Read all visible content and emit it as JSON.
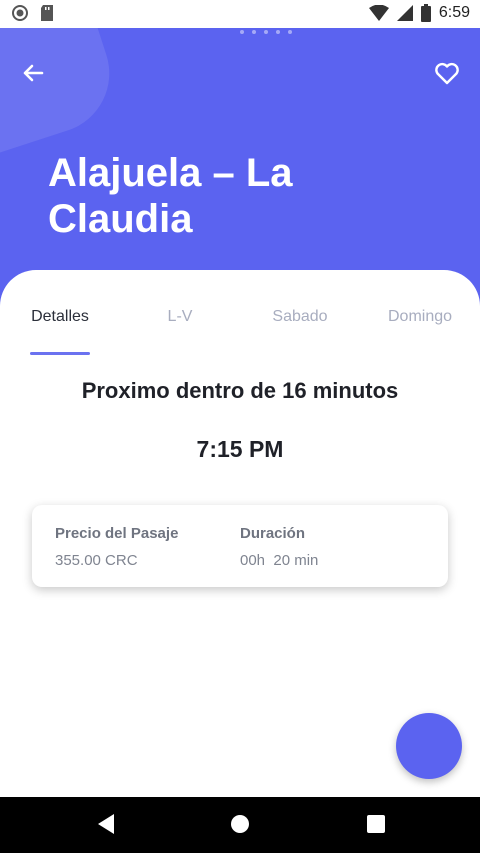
{
  "status": {
    "time": "6:59"
  },
  "header": {
    "title": "Alajuela – La Claudia",
    "back_icon": "arrow-left-icon",
    "favorite_icon": "heart-outline-icon",
    "color": "#5b63f0"
  },
  "tabs": [
    {
      "label": "Detalles",
      "active": true
    },
    {
      "label": "L-V",
      "active": false
    },
    {
      "label": "Sabado",
      "active": false
    },
    {
      "label": "Domingo",
      "active": false
    }
  ],
  "next": {
    "message": "Proximo dentro de 16 minutos",
    "time": "7:15 PM"
  },
  "card": {
    "price_label": "Precio del Pasaje",
    "price_value": "355.00 CRC",
    "duration_label": "Duración",
    "duration_value": "00h  20 min"
  },
  "colors": {
    "accent": "#5b63f0",
    "tab_indicator": "#6b72f0"
  }
}
